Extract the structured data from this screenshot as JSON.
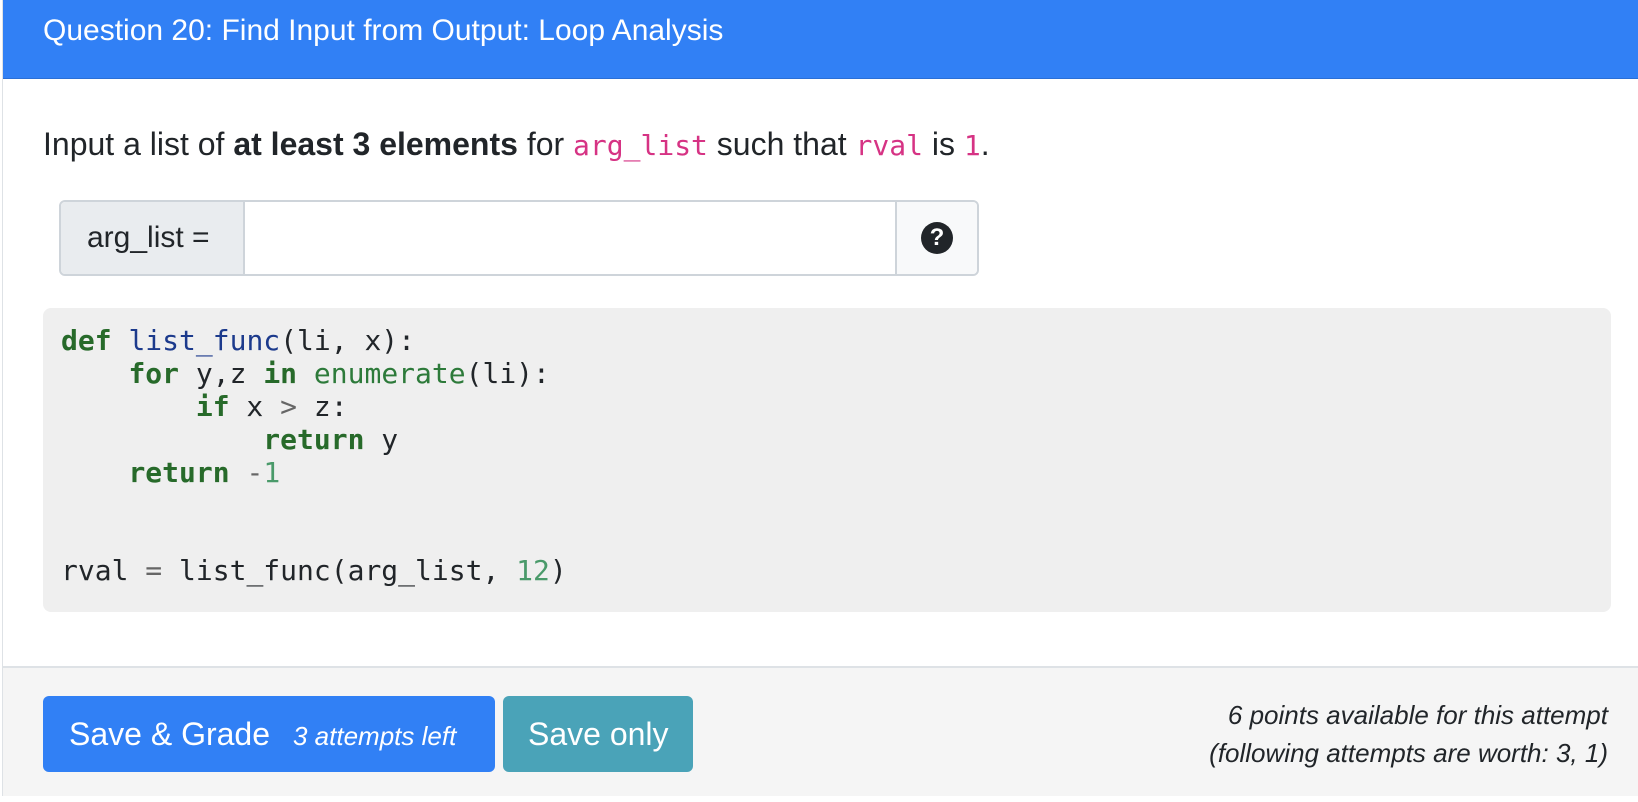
{
  "header": {
    "title": "Question 20: Find Input from Output: Loop Analysis"
  },
  "prompt": {
    "part1": "Input a list of ",
    "bold": "at least 3 elements",
    "part2": " for ",
    "code1": "arg_list",
    "part3": " such that ",
    "code2": "rval",
    "part4": " is ",
    "code3": "1",
    "part5": "."
  },
  "input": {
    "label": "arg_list =",
    "value": "",
    "placeholder": "",
    "help_icon": "question-circle-icon"
  },
  "code": {
    "lines": [
      "def list_func(li, x):",
      "    for y,z in enumerate(li):",
      "        if x > z:",
      "            return y",
      "    return -1",
      "",
      "",
      "rval = list_func(arg_list, 12)"
    ]
  },
  "footer": {
    "grade_label": "Save & Grade",
    "attempts_label": "3 attempts left",
    "save_label": "Save only",
    "points_line1": "6 points available for this attempt",
    "points_line2": "(following attempts are worth: 3, 1)"
  },
  "colors": {
    "header_bg": "#3180f5",
    "grade_btn": "#3180f5",
    "save_btn": "#4aa3b8",
    "code_ref": "#d63384"
  }
}
